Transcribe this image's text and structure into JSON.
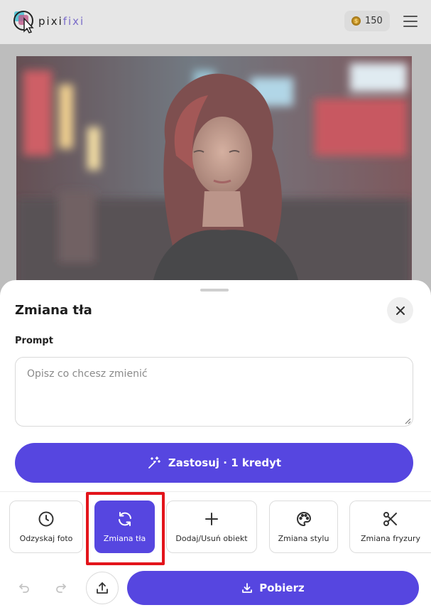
{
  "header": {
    "logo_text_a": "pixi",
    "logo_text_b": "fixi",
    "credits": "150",
    "coin_icon": "coin-icon",
    "menu_icon": "hamburger-menu-icon"
  },
  "photo": {
    "description_icon": "portrait-photo"
  },
  "sheet": {
    "title": "Zmiana tła",
    "prompt_label": "Prompt",
    "prompt_placeholder": "Opisz co chcesz zmienić",
    "prompt_value": "",
    "apply_label": "Zastosuj · 1 kredyt"
  },
  "tools": [
    {
      "label": "Odzyskaj foto",
      "icon": "clock-icon",
      "active": false
    },
    {
      "label": "Zmiana tła",
      "icon": "refresh-icon",
      "active": true
    },
    {
      "label": "Dodaj/Usuń obiekt",
      "icon": "plus-icon",
      "active": false
    },
    {
      "label": "Zmiana stylu",
      "icon": "palette-icon",
      "active": false
    },
    {
      "label": "Zmiana fryzury",
      "icon": "scissors-icon",
      "active": false
    }
  ],
  "footer": {
    "download_label": "Pobierz"
  },
  "colors": {
    "accent": "#5646e0",
    "highlight": "#e3141b"
  }
}
